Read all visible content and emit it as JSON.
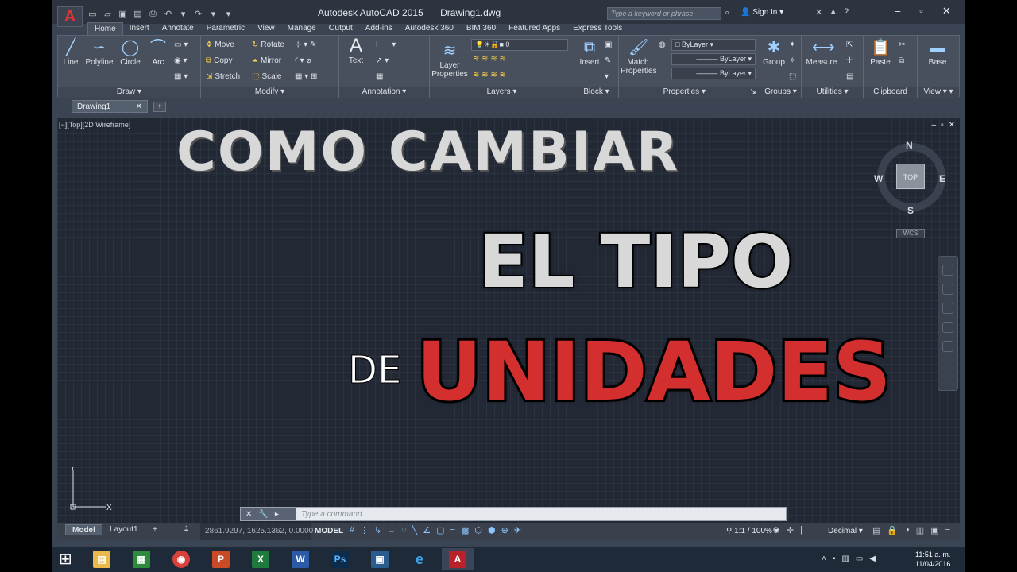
{
  "titlebar": {
    "app_name": "Autodesk AutoCAD 2015",
    "doc_name": "Drawing1.dwg",
    "search_placeholder": "Type a keyword or phrase",
    "sign_in": "Sign In"
  },
  "ribbon_tabs": [
    "Home",
    "Insert",
    "Annotate",
    "Parametric",
    "View",
    "Manage",
    "Output",
    "Add-ins",
    "Autodesk 360",
    "BIM 360",
    "Featured Apps",
    "Express Tools"
  ],
  "ribbon": {
    "draw": {
      "label": "Draw",
      "line": "Line",
      "polyline": "Polyline",
      "circle": "Circle",
      "arc": "Arc"
    },
    "modify": {
      "label": "Modify",
      "move": "Move",
      "rotate": "Rotate",
      "copy": "Copy",
      "mirror": "Mirror",
      "stretch": "Stretch",
      "scale": "Scale"
    },
    "annotation": {
      "label": "Annotation",
      "text": "Text"
    },
    "layers": {
      "label": "Layers",
      "layer_properties": "Layer\nProperties",
      "current_layer": "0"
    },
    "block": {
      "label": "Block",
      "insert": "Insert"
    },
    "properties": {
      "label": "Properties",
      "match": "Match\nProperties",
      "color": "ByLayer",
      "linetype": "ByLayer",
      "lineweight": "ByLayer"
    },
    "groups": {
      "label": "Groups",
      "group": "Group"
    },
    "utilities": {
      "label": "Utilities",
      "measure": "Measure"
    },
    "clipboard": {
      "label": "Clipboard",
      "paste": "Paste"
    },
    "view": {
      "label": "View",
      "base": "Base"
    }
  },
  "doc_tab": "Drawing1",
  "viewport": {
    "label": "[−][Top][2D Wireframe]",
    "compass": {
      "n": "N",
      "s": "S",
      "e": "E",
      "w": "W",
      "cube": "TOP",
      "wcs": "WCS"
    }
  },
  "overlay_text": {
    "line1": "COMO CAMBIAR",
    "line2": "EL TIPO",
    "line3": "DE",
    "line4": "UNIDADES"
  },
  "command": {
    "placeholder": "Type a command"
  },
  "status": {
    "tab_model": "Model",
    "tab_layout": "Layout1",
    "coords": "2861.9297, 1625.1362, 0.0000",
    "model": "MODEL",
    "scale": "1:1 / 100%",
    "units": "Decimal"
  },
  "taskbar": {
    "time": "11:51 a. m.",
    "date": "11/04/2016"
  }
}
